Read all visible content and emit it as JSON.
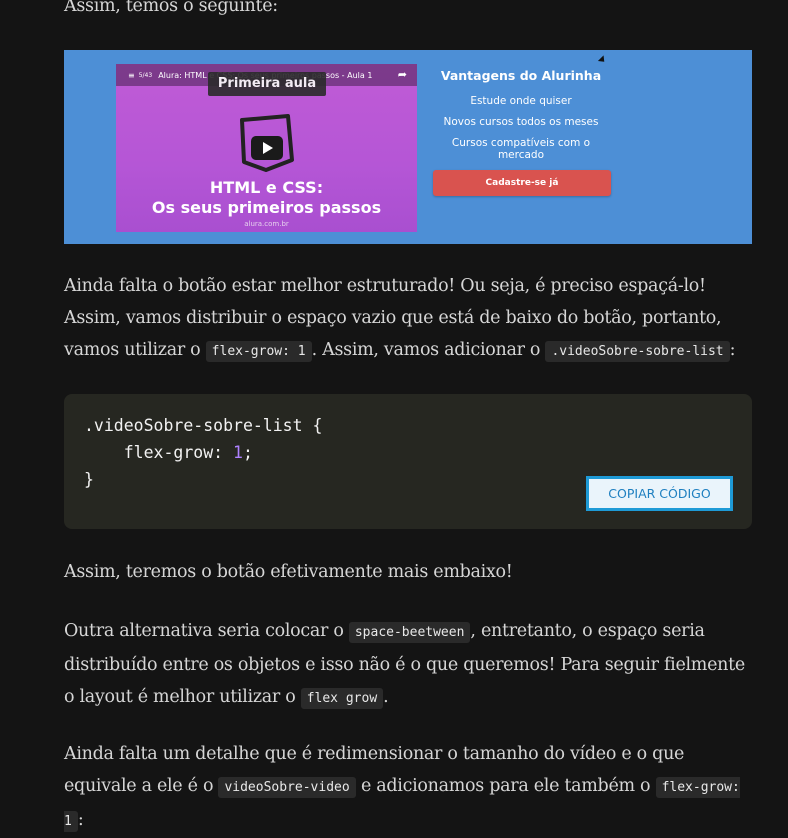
{
  "paragraphs": {
    "intro": "Assim, temos o seguinte:",
    "p2_a": "Ainda falta o botão estar melhor estruturado! Ou seja, é preciso espaçá-lo! Assim, vamos distribuir o espaço vazio que está de baixo do botão, portanto, vamos utilizar o ",
    "p2_code1": "flex-grow: 1",
    "p2_b": ". Assim, vamos adicionar o ",
    "p2_code2": ".videoSobre-sobre-list",
    "p2_c": ":",
    "p3": "Assim, teremos o botão efetivamente mais embaixo!",
    "p4_a": "Outra alternativa seria colocar o ",
    "p4_code1": "space-beetween",
    "p4_b": ", entretanto, o espaço seria distribuído entre os objetos e isso não é o que queremos! Para seguir fielmente o layout é melhor utilizar o ",
    "p4_code2": "flex grow",
    "p4_c": ".",
    "p5_a": "Ainda falta um detalhe que é redimensionar o tamanho do vídeo e o que equivale a ele é o ",
    "p5_code1": "videoSobre-video",
    "p5_b": " e adicionamos para ele também o ",
    "p5_code2": "flex-grow: 1",
    "p5_c": ":"
  },
  "screenshot": {
    "video_title": "Alura: HTML e CSS: Os seus primeiros passos - Aula 1",
    "video_counter": "5/43",
    "aula_pill": "Primeira aula",
    "heading_line1": "HTML e CSS:",
    "heading_line2": "Os seus primeiros passos",
    "site": "alura.com.br",
    "aside_title": "Vantagens do Alurinha",
    "aside_items": [
      "Estude onde quiser",
      "Novos cursos todos os meses",
      "Cursos compatíveis com o mercado"
    ],
    "aside_cta": "Cadastre-se já",
    "bg_color": "#4d8fd6"
  },
  "code": {
    "line1": ".videoSobre-sobre-list {",
    "line2_prop": "    flex-grow: ",
    "line2_num": "1",
    "line2_end": ";",
    "line3": "}",
    "copy_label": "COPIAR CÓDIGO"
  },
  "colors": {
    "page_bg": "#141414",
    "code_bg": "#262721",
    "copy_border": "#1e9ad6",
    "number_purple": "#ae81ff"
  }
}
